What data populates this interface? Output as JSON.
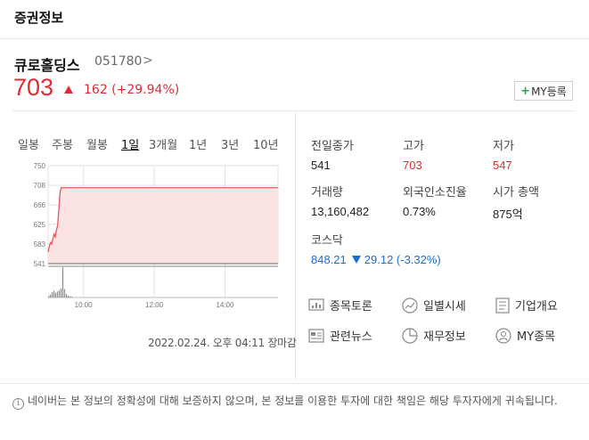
{
  "header": {
    "title": "증권정보"
  },
  "stock": {
    "name": "큐로홀딩스",
    "code": "051780",
    "code_arrow": ">",
    "price": "703",
    "change": "162 (+29.94%)",
    "my_button_plus": "+",
    "my_button_label": "MY등록"
  },
  "periods": [
    "일봉",
    "주봉",
    "월봉",
    "1일",
    "3개월",
    "1년",
    "3년",
    "10년"
  ],
  "active_period": "1일",
  "timestamp": "2022.02.24. 오후 04:11 장마감",
  "stats": {
    "prev_close": {
      "label": "전일종가",
      "value": "541"
    },
    "high": {
      "label": "고가",
      "value": "703"
    },
    "low": {
      "label": "저가",
      "value": "547"
    },
    "volume": {
      "label": "거래량",
      "value": "13,160,482"
    },
    "foreign_ratio": {
      "label": "외국인소진율",
      "value": "0.73%"
    },
    "market_cap": {
      "label": "시가 총액",
      "value": "875억"
    },
    "index": {
      "label": "코스닥",
      "value": "848.21",
      "change": "29.12 (-3.32%)"
    }
  },
  "links": {
    "forum": "종목토론",
    "daily": "일별시세",
    "company": "기업개요",
    "news": "관련뉴스",
    "financial": "재무정보",
    "my_stock": "MY종목"
  },
  "notice": "네이버는 본 정보의 정확성에 대해 보증하지 않으며, 본 정보를 이용한 투자에 대한 책임은 해당 투자자에게 귀속됩니다.",
  "chart_data": {
    "type": "area",
    "y_ticks": [
      "750",
      "708",
      "666",
      "625",
      "583",
      "541"
    ],
    "ylim": [
      541,
      750
    ],
    "x_ticks": [
      "10:00",
      "12:00",
      "14:00"
    ],
    "baseline": 541,
    "price_series": {
      "x": [
        "09:00",
        "09:02",
        "09:04",
        "09:06",
        "09:08",
        "09:10",
        "09:12",
        "09:14",
        "09:16",
        "09:18",
        "09:20",
        "09:22",
        "09:24",
        "15:30"
      ],
      "values": [
        566,
        578,
        586,
        583,
        594,
        604,
        598,
        612,
        622,
        654,
        690,
        703,
        703,
        703
      ]
    },
    "volume_series": {
      "x": [
        "09:00",
        "09:03",
        "09:06",
        "09:09",
        "09:12",
        "09:15",
        "09:18",
        "09:21",
        "09:24",
        "09:27",
        "09:30",
        "09:33",
        "09:36",
        "09:39"
      ],
      "values": [
        0.05,
        0.1,
        0.18,
        0.22,
        0.16,
        0.2,
        0.24,
        0.3,
        1.0,
        0.28,
        0.12,
        0.06,
        0.04,
        0.03
      ]
    },
    "colors": {
      "line": "#e8575e",
      "fill": "#fbe3e4",
      "volume": "#8a8a8a",
      "grid": "#e2e2e2"
    }
  }
}
